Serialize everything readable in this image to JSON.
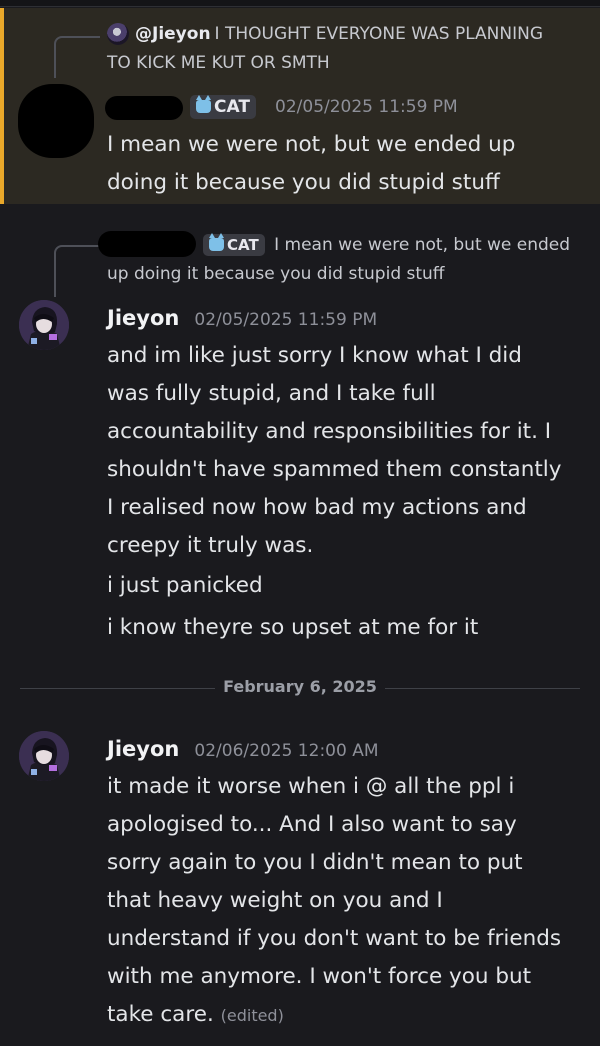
{
  "message1": {
    "reply": {
      "mention": "@Jieyon",
      "text_line1": "I THOUGHT EVERYONE WAS PLANNING",
      "text_line2": "TO KICK ME KUT OR SMTH"
    },
    "role": "CAT",
    "timestamp": "02/05/2025 11:59 PM",
    "lines": [
      "I mean we were not, but we ended up",
      "doing it because you did stupid stuff"
    ]
  },
  "message2": {
    "reply": {
      "role": "CAT",
      "text_line1": "I mean we were not, but we ended",
      "text_line2": "up doing it because you did stupid stuff"
    },
    "username": "Jieyon",
    "timestamp": "02/05/2025 11:59 PM",
    "lines": [
      "and im like just sorry I know what I did",
      "was fully stupid, and I take full",
      "accountability and responsibilities for it. I",
      "shouldn't have spammed them constantly",
      "I realised now how bad my actions and",
      "creepy it truly was."
    ],
    "followups": [
      "i just panicked",
      "i know theyre so upset at me for it"
    ]
  },
  "divider": {
    "date": "February 6, 2025"
  },
  "message3": {
    "username": "Jieyon",
    "timestamp": "02/06/2025 12:00 AM",
    "lines": [
      "it made it worse when i @ all the ppl i",
      "apologised to... And I also want to say",
      "sorry again to you I didn't mean to put",
      "that heavy weight on you and I",
      "understand if you don't want to be friends",
      "with me anymore. I won't force you but",
      "take care."
    ],
    "edited": "(edited)"
  },
  "colors": {
    "background": "#1a1a1e",
    "highlight_background": "#2c2922",
    "highlight_bar": "#e9a82a",
    "role_icon": "#7ec0e8"
  },
  "icons": {
    "role": "cat-icon",
    "avatar": "anime-avatar"
  }
}
